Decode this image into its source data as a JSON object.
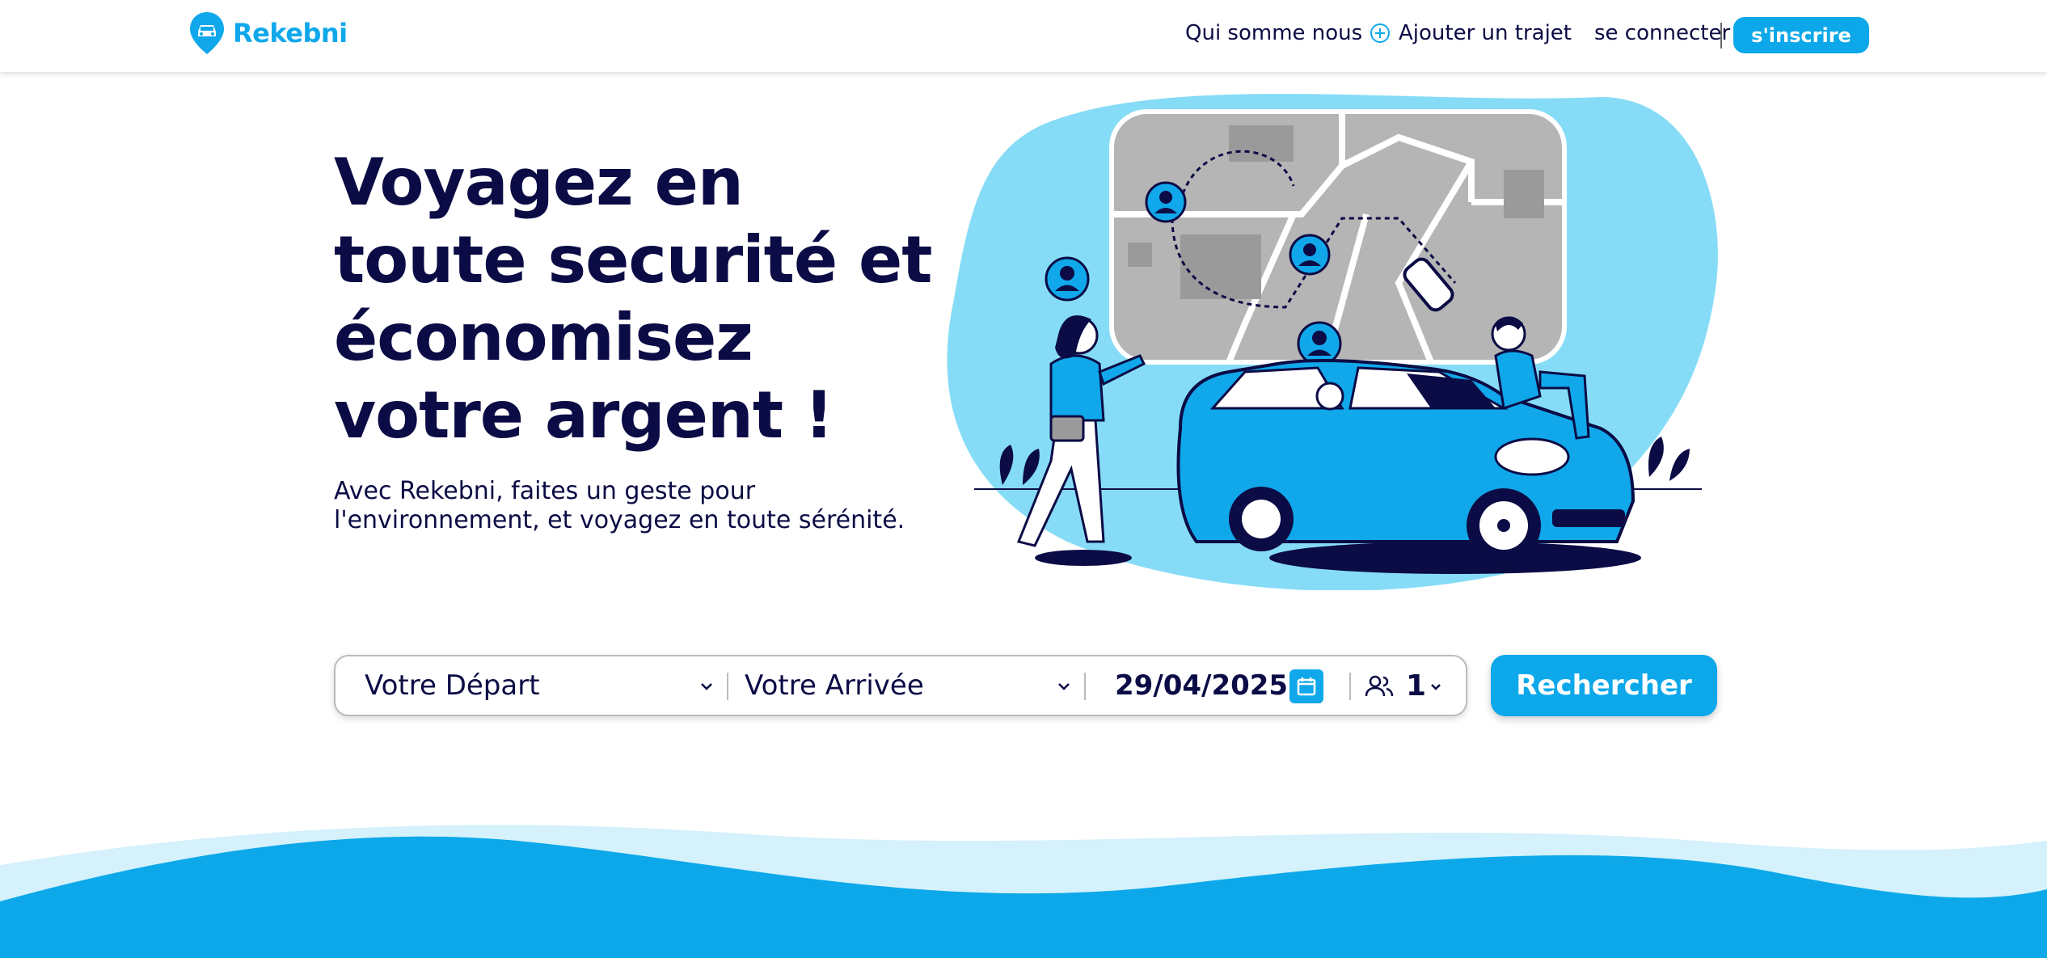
{
  "brand": {
    "name": "Rekebni",
    "accent": "#0ca8ea",
    "text_color": "#0b0b45"
  },
  "nav": {
    "about": "Qui somme nous",
    "add_trip": "Ajouter un trajet",
    "login": "se connecter",
    "signup": "s'inscrire"
  },
  "hero": {
    "title": "Voyagez en toute securité et économisez votre argent !",
    "subtitle": "Avec Rekebni, faites un geste pour l'environnement, et voyagez en toute sérénité."
  },
  "search": {
    "departure": "Votre Départ",
    "arrival": "Votre Arrivée",
    "date": "29/04/2025",
    "passengers": "1",
    "button": "Rechercher"
  },
  "icons": [
    "car-pin-logo-icon",
    "plus-circle-icon",
    "chevron-down-icon",
    "calendar-icon",
    "users-icon"
  ]
}
